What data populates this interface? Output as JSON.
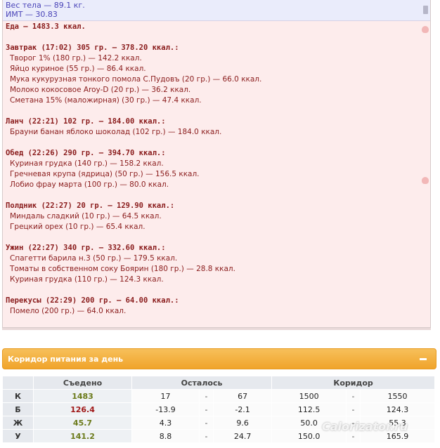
{
  "stats": {
    "weight": "Вес тела — 89.1 кг.",
    "bmi": "ИМТ — 30.83"
  },
  "food_total": "Еда — 1483.3 ккал.",
  "meals": [
    {
      "head": "Завтрак (17:02) 305 гр. — 378.20 ккал.:",
      "items": [
        "Творог 1% (180 гр.) — 142.2 ккал.",
        "Яйцо куриное (55 гр.) — 86.4 ккал.",
        "Мука кукурузная тонкого помола С.Пудовъ (20 гр.) — 66.0 ккал.",
        "Молоко кокосовое Aroy-D (20 гр.) — 36.2 ккал.",
        "Сметана 15% (маложирная) (30 гр.) — 47.4 ккал."
      ]
    },
    {
      "head": "Ланч (22:21) 102 гр. — 184.00 ккал.:",
      "items": [
        "Брауни банан яблоко шоколад (102 гр.) — 184.0 ккал."
      ]
    },
    {
      "head": "Обед (22:26) 290 гр. — 394.70 ккал.:",
      "items": [
        "Куриная грудка (140 гр.) — 158.2 ккал.",
        "Гречневая крупа (ядрица) (50 гр.) — 156.5 ккал.",
        "Лобио фрау марта (100 гр.) — 80.0 ккал."
      ]
    },
    {
      "head": "Полдник (22:27) 20 гр. — 129.90 ккал.:",
      "items": [
        "Миндаль сладкий (10 гр.) — 64.5 ккал.",
        "Грецкий орех (10 гр.) — 65.4 ккал."
      ]
    },
    {
      "head": "Ужин (22:27) 340 гр. — 332.60 ккал.:",
      "items": [
        "Спагетти барила н.3 (50 гр.) — 179.5 ккал.",
        "Томаты в собственном соку Боярин (180 гр.) — 28.8 ккал.",
        "Куриная грудка (110 гр.) — 124.3 ккал."
      ]
    },
    {
      "head": "Перекусы (22:29) 200 гр. — 64.00 ккал.:",
      "items": [
        "Помело (200 гр.) — 64.0 ккал."
      ]
    }
  ],
  "corridor": {
    "title": "Коридор питания за день",
    "headers": [
      "Съедено",
      "Осталось",
      "Коридор"
    ],
    "rows": [
      {
        "label": "К",
        "eaten": "1483",
        "eaten_color": "#6b7a1a",
        "rem_lo": "17",
        "rem_hi": "67",
        "cor_lo": "1500",
        "cor_hi": "1550"
      },
      {
        "label": "Б",
        "eaten": "126.4",
        "eaten_color": "#a01818",
        "rem_lo": "-13.9",
        "rem_hi": "-2.1",
        "cor_lo": "112.5",
        "cor_hi": "124.3"
      },
      {
        "label": "Ж",
        "eaten": "45.7",
        "eaten_color": "#6b7a1a",
        "rem_lo": "4.3",
        "rem_hi": "9.6",
        "cor_lo": "50.0",
        "cor_hi": "55.3"
      },
      {
        "label": "У",
        "eaten": "141.2",
        "eaten_color": "#6b7a1a",
        "rem_lo": "8.8",
        "rem_hi": "24.7",
        "cor_lo": "150.0",
        "cor_hi": "165.9"
      }
    ],
    "dash": "-"
  },
  "watermark": "Calorizator.ru"
}
